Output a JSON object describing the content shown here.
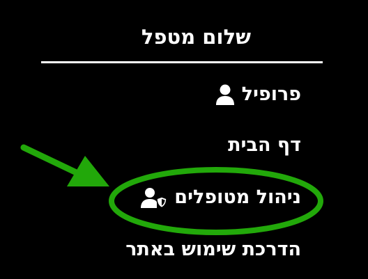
{
  "menu": {
    "greeting": "שלום מטפל",
    "items": [
      {
        "label": "פרופיל",
        "icon": "user-icon"
      },
      {
        "label": "דף הבית",
        "icon": ""
      },
      {
        "label": "ניהול מטופלים",
        "icon": "user-shield-icon"
      },
      {
        "label": "הדרכת שימוש באתר",
        "icon": ""
      }
    ]
  },
  "annotation": {
    "color": "#22a80a",
    "highlighted_item": "ניהול מטופלים"
  }
}
